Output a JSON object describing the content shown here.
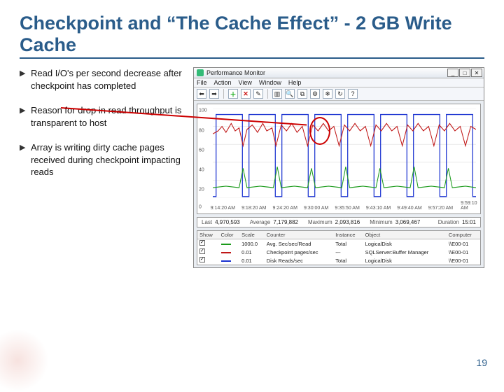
{
  "slide": {
    "title": "Checkpoint and “The Cache Effect” - 2 GB Write Cache",
    "bullets": [
      "Read I/O's per second decrease after checkpoint has completed",
      "Reason for drop in read throughput is transparent to host",
      "Array is writing dirty cache pages received during checkpoint impacting reads"
    ],
    "page_number": "19"
  },
  "perfmon": {
    "window_title": "Performance Monitor",
    "menu": [
      "File",
      "Action",
      "View",
      "Window",
      "Help"
    ],
    "toolbar_icons": [
      "back-icon",
      "forward-icon",
      "add-icon",
      "remove-icon",
      "refresh-icon",
      "help-icon",
      "divider",
      "chart-icon",
      "group-icon",
      "copy-icon",
      "props-icon",
      "freeze-icon",
      "update-icon"
    ],
    "y_ticks": [
      "100",
      "80",
      "60",
      "40",
      "20",
      "0"
    ],
    "x_ticks": [
      "9:14:20 AM",
      "9:18:20 AM",
      "9:24:20 AM",
      "9:30:00 AM",
      "9:35:50 AM",
      "9:43:10 AM",
      "9:49:40 AM",
      "9:57:20 AM",
      "9:59:10 AM"
    ],
    "stats": {
      "Last": "4,970,593",
      "Average": "7,179,882",
      "Maximum": "2,093,816",
      "Minimum": "3,069,467",
      "Duration": "15:01"
    },
    "legend_headers": [
      "Show",
      "Color",
      "Scale",
      "Counter",
      "Instance",
      "Object",
      "Computer"
    ],
    "legend_rows": [
      {
        "color": "#1a9a1a",
        "scale": "1000.0",
        "counter": "Avg. Sec/sec/Read",
        "instance": "Total",
        "object": "LogicalDisk",
        "computer": "\\\\E00-01"
      },
      {
        "color": "#c01818",
        "scale": "0.01",
        "counter": "Checkpoint pages/sec",
        "instance": "---",
        "object": "SQLServer:Buffer Manager",
        "computer": "\\\\E00-01"
      },
      {
        "color": "#1830d0",
        "scale": "0.01",
        "counter": "Disk Reads/sec",
        "instance": "Total",
        "object": "LogicalDisk",
        "computer": "\\\\E00-01"
      }
    ]
  },
  "chart_data": {
    "type": "line",
    "x": [
      "9:14",
      "9:18",
      "9:24",
      "9:30",
      "9:36",
      "9:43",
      "9:50",
      "9:57",
      "9:59"
    ],
    "ylim": [
      0,
      100
    ],
    "title": "",
    "xlabel": "",
    "ylabel": "",
    "note": "Values estimated from gridlines; periodic checkpoint spikes with correlated read dips.",
    "series": [
      {
        "name": "Disk Reads/sec (blue)",
        "color": "#1830d0",
        "values_pattern": "square-wave 0↔95, eight on/off cycles across window"
      },
      {
        "name": "Checkpoint pages/sec (red)",
        "color": "#c01818",
        "values_pattern": "noisy 70–90 during checkpoint, dips to ~55 between cycles"
      },
      {
        "name": "Avg sec/Read (green)",
        "color": "#1a9a1a",
        "values_pattern": "mostly ~12, brief spikes to ~35 at cycle boundaries"
      }
    ]
  }
}
